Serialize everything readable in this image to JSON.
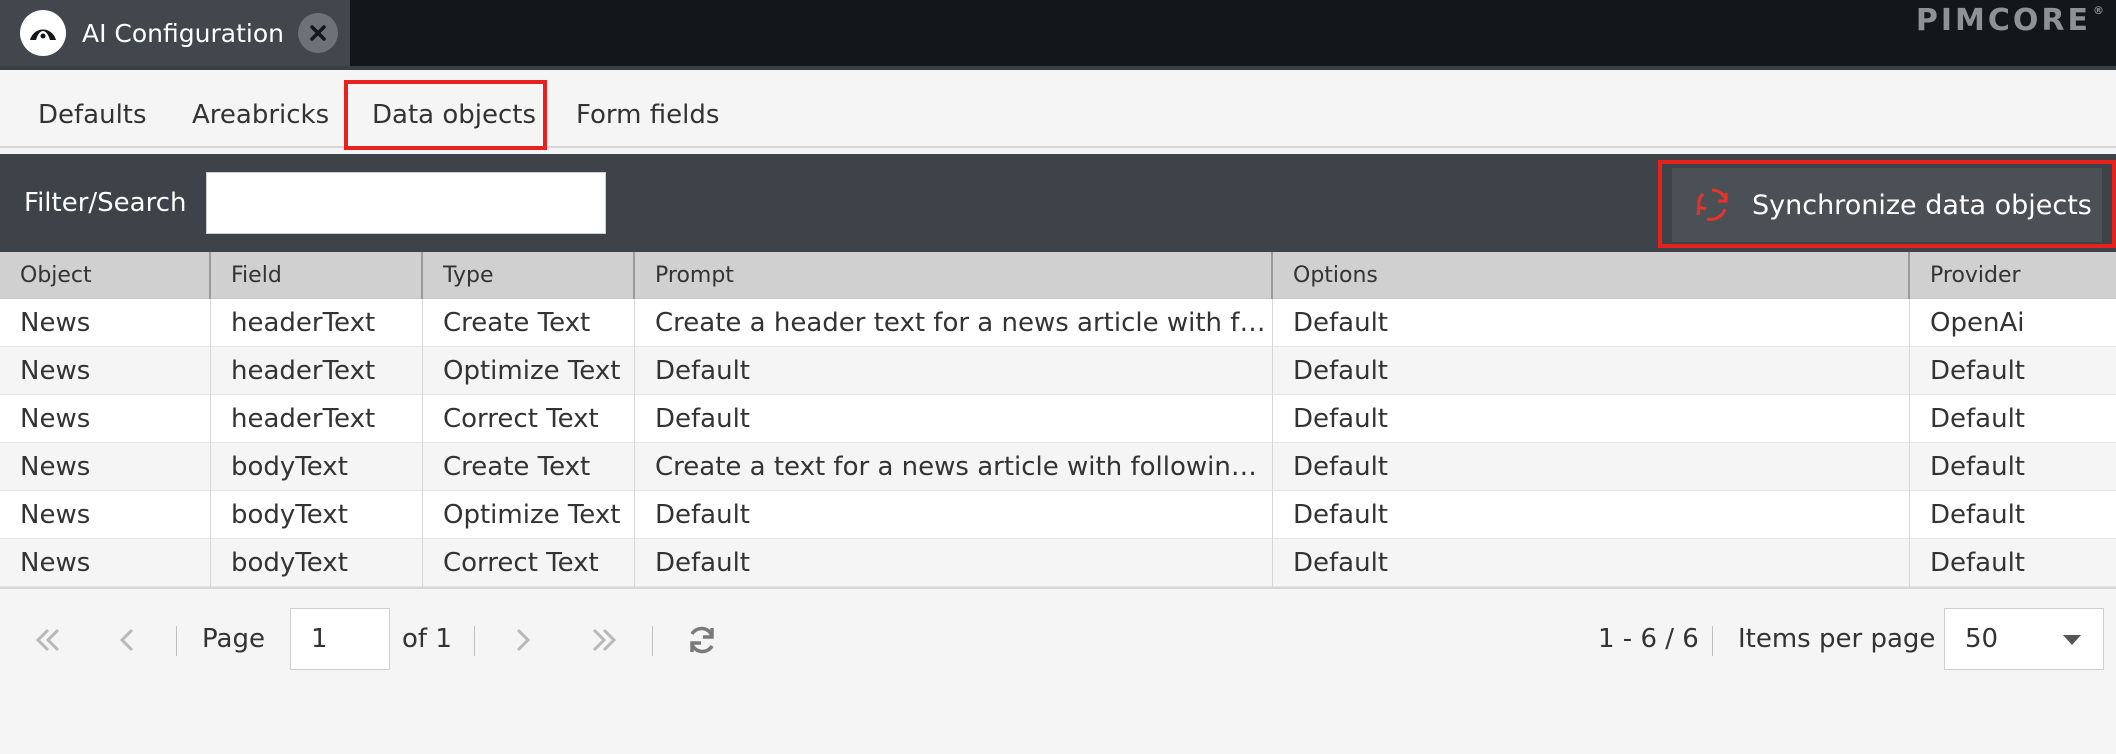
{
  "window": {
    "tab_title": "AI Configuration",
    "brand": "PIMCORE",
    "brand_mark": "®"
  },
  "subtabs": [
    {
      "label": "Defaults"
    },
    {
      "label": "Areabricks"
    },
    {
      "label": "Data objects",
      "active": true
    },
    {
      "label": "Form fields"
    }
  ],
  "toolbar": {
    "filter_label": "Filter/Search",
    "filter_value": "",
    "sync_label": "Synchronize data objects",
    "sync_icon": "sync-icon"
  },
  "grid": {
    "columns": [
      "Object",
      "Field",
      "Type",
      "Prompt",
      "Options",
      "Provider"
    ],
    "rows": [
      [
        "News",
        "headerText",
        "Create Text",
        "Create a header text for a news article with foll…",
        "Default",
        "OpenAi"
      ],
      [
        "News",
        "headerText",
        "Optimize Text",
        "Default",
        "Default",
        "Default"
      ],
      [
        "News",
        "headerText",
        "Correct Text",
        "Default",
        "Default",
        "Default"
      ],
      [
        "News",
        "bodyText",
        "Create Text",
        "Create a text for a news article with following in…",
        "Default",
        "Default"
      ],
      [
        "News",
        "bodyText",
        "Optimize Text",
        "Default",
        "Default",
        "Default"
      ],
      [
        "News",
        "bodyText",
        "Correct Text",
        "Default",
        "Default",
        "Default"
      ]
    ]
  },
  "paging": {
    "page_label": "Page",
    "page_value": "1",
    "of_label": "of 1",
    "range": "1 - 6 / 6",
    "items_per_page_label": "Items per page",
    "items_per_page_value": "50"
  },
  "colors": {
    "highlight": "#e8211f",
    "topbar": "#13161a",
    "toolbar": "#3e4349"
  }
}
